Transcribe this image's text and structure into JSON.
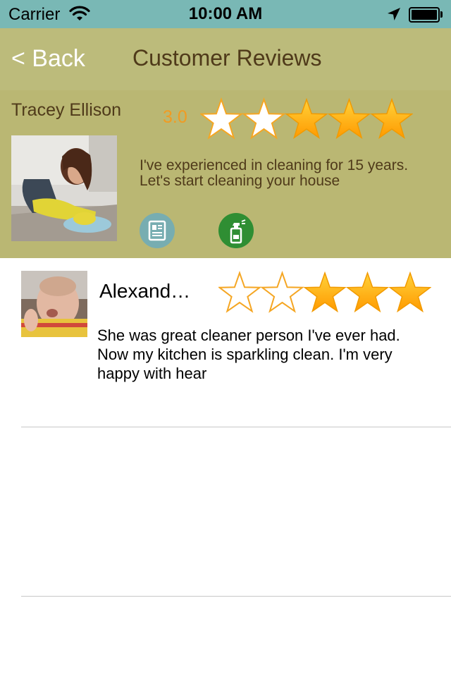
{
  "status_bar": {
    "carrier": "Carrier",
    "time": "10:00 AM",
    "icons": [
      "wifi-icon",
      "location-arrow-icon",
      "battery-icon"
    ]
  },
  "nav": {
    "back_label": "< Back",
    "title": "Customer Reviews"
  },
  "provider": {
    "name": "Tracey Ellison",
    "rating": "3.0",
    "rating_stars": {
      "filled": 3,
      "total": 5
    },
    "description": "I've experienced in cleaning for 15 years. Let's start cleaning your house",
    "actions": [
      "id-card-icon",
      "spray-bottle-icon"
    ]
  },
  "reviews": [
    {
      "name": "Alexand…",
      "stars": {
        "filled": 3,
        "total": 5
      },
      "text": "She was great cleaner person I've ever had.  Now my kitchen is sparkling clean. I'm very happy with hear"
    }
  ],
  "colors": {
    "status_bar": "#79b8b5",
    "nav_bar": "#bcbb7b",
    "profile_bg": "#bab773",
    "title_text": "#4f3a1a",
    "rating_orange": "#f19b22",
    "star_fill": "#ffb400"
  }
}
